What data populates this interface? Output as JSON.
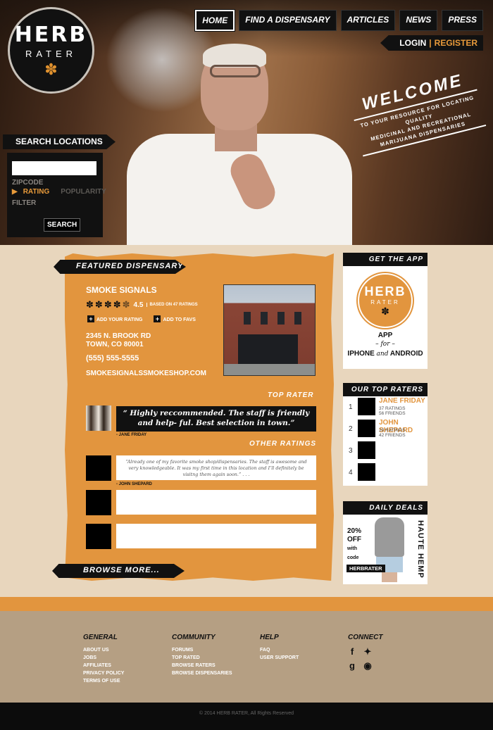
{
  "logo": {
    "line1": "HERB",
    "line2": "RATER"
  },
  "nav": {
    "items": [
      "HOME",
      "FIND A DISPENSARY",
      "ARTICLES",
      "NEWS",
      "PRESS"
    ]
  },
  "auth": {
    "login": "LOGIN",
    "sep": "|",
    "register": "REGISTER"
  },
  "welcome": {
    "title": "WELCOME",
    "subtitle_1": "TO YOUR RESOURCE FOR LOCATING QUALITY",
    "subtitle_2": "MEDICINAL AND RECREATIONAL",
    "subtitle_3": "MARIJUANA DISPENSARIES"
  },
  "search": {
    "title": "SEARCH LOCATIONS",
    "zip_label": "ZIPCODE",
    "rating": "RATING",
    "popularity": "POPULARITY",
    "filter": "FILTER",
    "button": "SEARCH"
  },
  "featured": {
    "tag": "FEATURED DISPENSARY",
    "name": "SMOKE SIGNALS",
    "rating": "4.5",
    "based_on": "BASED ON 47 RATINGS",
    "add_rating": "ADD YOUR RATING",
    "add_favs": "ADD TO FAVS",
    "address_1": "2345 N. BROOK RD",
    "address_2": "TOWN, CO 80001",
    "phone": "(555) 555-5555",
    "website": "SMOKESIGNALSSMOKESHOP.COM"
  },
  "top_rater": {
    "title": "TOP RATER",
    "quote": "“ Highly reccommended. The staff is friendly and help- ful. Best selection in town.”",
    "author": "- JANE FRIDAY"
  },
  "other": {
    "title": "OTHER RATINGS",
    "comment": "“Already one of my favorite smoke shop/dispensaries.  The staff is awesome and very knowledgeable. It was my first time in this location and I’ll definitely be visitng them again soon.”  . . .",
    "author": "- JOHN SHEPARD"
  },
  "browse": {
    "label": "BROWSE MORE..."
  },
  "app": {
    "title": "GET THE APP",
    "logo1": "HERB",
    "logo2": "RATER",
    "line1": "APP",
    "for": "– for –",
    "iphone": "IPHONE",
    "and": "and",
    "android": "ANDROID"
  },
  "top_raters": {
    "title": "OUR TOP RATERS",
    "items": [
      {
        "n": "1",
        "name": "JANE FRIDAY",
        "ratings": "37 RATINGS",
        "friends": "56 FRIENDS"
      },
      {
        "n": "2",
        "name": "JOHN SHEPARD",
        "ratings": "28 RATINGS",
        "friends": "42 FRIENDS"
      },
      {
        "n": "3"
      },
      {
        "n": "4"
      }
    ]
  },
  "deals": {
    "title": "DAILY DEALS",
    "pct": "20%",
    "off": "OFF",
    "with": "with",
    "code_word": "code",
    "code": "HERBRATER",
    "brand": "HAUTE HEMP"
  },
  "footer": {
    "general": {
      "title": "GENERAL",
      "items": [
        "ABOUT US",
        "JOBS",
        "AFFILIATES",
        "PRIVACY POLICY",
        "TERMS OF USE"
      ]
    },
    "community": {
      "title": "COMMUNITY",
      "items": [
        "FORUMS",
        "TOP RATED",
        "BROWSE RATERS",
        "BROWSE DISPENSARIES"
      ]
    },
    "help": {
      "title": "HELP",
      "items": [
        "FAQ",
        "USER SUPPORT"
      ]
    },
    "connect": {
      "title": "CONNECT",
      "icons": [
        "facebook-icon",
        "twitter-icon",
        "google-plus-icon",
        "rss-icon"
      ]
    },
    "copyright": "© 2014 HERB RATER, All Rights Reserved"
  },
  "colors": {
    "accent": "#e2953e",
    "dark": "#111111",
    "footer": "#b59f83"
  }
}
